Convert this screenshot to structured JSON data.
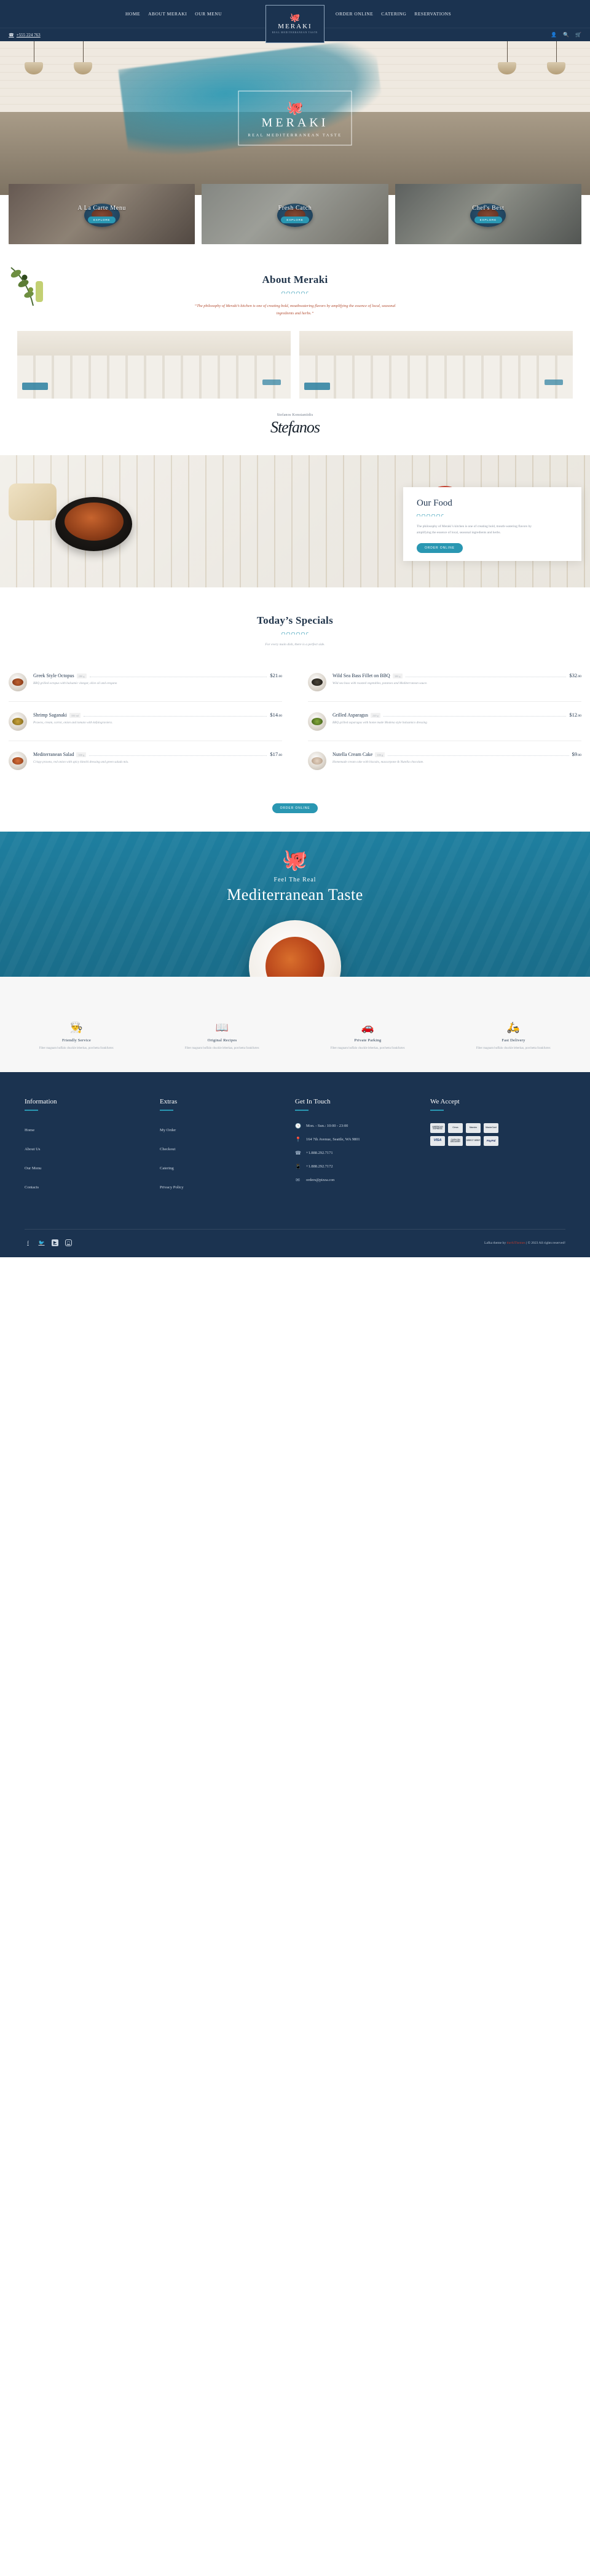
{
  "header": {
    "nav_left": [
      {
        "label": "HOME"
      },
      {
        "label": "ABOUT MERAKI"
      },
      {
        "label": "OUR MENU"
      }
    ],
    "nav_right": [
      {
        "label": "ORDER ONLINE"
      },
      {
        "label": "CATERING"
      },
      {
        "label": "RESERVATIONS"
      }
    ],
    "logo": {
      "mark": "🐙",
      "word": "MERAKI",
      "tagline": "REAL MEDITERRANEAN TASTE"
    },
    "phone": "+555 224 763",
    "phone_icon": "phone-icon",
    "util_icons": [
      "user-icon",
      "search-icon",
      "cart-icon"
    ],
    "colors": {
      "navy": "#1b3350",
      "teal": "#2a97b2"
    }
  },
  "hero": {
    "octopus_icon": "🐙",
    "title": "MERAKI",
    "subtitle": "REAL MEDITERRANEAN TASTE"
  },
  "cards": [
    {
      "title": "A La Carte Menu",
      "button": "Explore"
    },
    {
      "title": "Fresh Catch",
      "button": "Explore"
    },
    {
      "title": "Chef's Best",
      "button": "Explore"
    }
  ],
  "about": {
    "title": "About Meraki",
    "text": "“The philosophy of Meraki’s kitchen is one of creating bold, mouthwatering flavors by amplifying the essence of local, seasonal ingredients and herbs.”",
    "signer_name": "Stefanos Konstantidis",
    "signature": "Stefanos"
  },
  "our_food": {
    "title": "Our Food",
    "text": "The philosophy of Meraki’s kitchen is one of creating bold, mouth-watering flavors by amplifying the essence of local, seasonal ingredients and herbs.",
    "button": "Order Online"
  },
  "specials": {
    "title": "Today’s Specials",
    "note": "For every main dish, there is a perfect side.",
    "button": "Order Online",
    "items": [
      {
        "name": "Greek Style Octopus",
        "weight": "280 g",
        "price": "$21",
        "cents": ".00",
        "desc": "BBQ grilled octopus with balsamic vinegar, olive oil and oregano",
        "thumb": "octopus-thumb"
      },
      {
        "name": "Wild Sea Bass Fillet on BBQ",
        "weight": "380 g",
        "price": "$32",
        "cents": ".00",
        "desc": "Wild sea bass with roasted vegetables, potatoes and Mediterranean sauce.",
        "thumb": "seabass-thumb"
      },
      {
        "name": "Shrimp Saganaki",
        "weight": "350 ml",
        "price": "$14",
        "cents": ".00",
        "desc": "Prawns, cream, carrot, onion and tomato with kefalograviera.",
        "thumb": "saganaki-thumb"
      },
      {
        "name": "Grilled Asparagus",
        "weight": "220 g",
        "price": "$12",
        "cents": ".00",
        "desc": "BBQ grilled asparagus with home made Modena style balsamico dressing",
        "thumb": "asparagus-thumb"
      },
      {
        "name": "Mediterranean Salad",
        "weight": "300 g",
        "price": "$17",
        "cents": ".00",
        "desc": "Crispy prawns, red onion with spicy kimchi dressing and green salads mix.",
        "thumb": "salad-thumb"
      },
      {
        "name": "Nutella Cream Cake",
        "weight": "180 g",
        "price": "$9",
        "cents": ".00",
        "desc": "Homemade cream cake with biscuits, mascarpone & Nutella chocolate.",
        "thumb": "cake-thumb"
      }
    ]
  },
  "banner": {
    "octopus_icon": "🐙",
    "line1": "Feel The Real",
    "line2": "Mediterranean Taste"
  },
  "features": [
    {
      "icon": "👨‍🍳",
      "icon_name": "waiter-icon",
      "title": "Friendly Service",
      "desc": "Fiber magnam buffalo chuckle leberkas, porchetta frankfurter."
    },
    {
      "icon": "📖",
      "icon_name": "recipe-book-icon",
      "title": "Original Recipes",
      "desc": "Fiber magnam buffalo chuckle leberkas, porchetta frankfurter."
    },
    {
      "icon": "🚗",
      "icon_name": "car-icon",
      "title": "Private Parking",
      "desc": "Fiber magnam buffalo chuckle leberkas, porchetta frankfurter."
    },
    {
      "icon": "🛵",
      "icon_name": "scooter-icon",
      "title": "Fast Delivery",
      "desc": "Fiber magnam buffalo chuckle leberkas, porchetta frankfurter."
    }
  ],
  "footer": {
    "col1": {
      "title": "Information",
      "links": [
        {
          "label": "Home"
        },
        {
          "label": "About Us"
        },
        {
          "label": "Our Menu"
        },
        {
          "label": "Contacts"
        }
      ]
    },
    "col2": {
      "title": "Extras",
      "links": [
        {
          "label": "My Order"
        },
        {
          "label": "Checkout"
        },
        {
          "label": "Catering"
        },
        {
          "label": "Privacy Policy"
        }
      ]
    },
    "col3": {
      "title": "Get In Touch",
      "items": [
        {
          "icon": "🕓",
          "icon_name": "clock-icon",
          "text": "Mon. - Sun.: 10:00 - 23:00"
        },
        {
          "icon": "📍",
          "icon_name": "pin-icon",
          "text": "164 7th Avenue, Seattle, WA 9801"
        },
        {
          "icon": "☎",
          "icon_name": "phone-icon",
          "text": "+1.888.292.7171"
        },
        {
          "icon": "📱",
          "icon_name": "mobile-icon",
          "text": "+1.888.292.7172"
        },
        {
          "icon": "✉",
          "icon_name": "email-icon",
          "text": "orders@pizza.con"
        }
      ]
    },
    "col4": {
      "title": "We Accept",
      "cards": [
        {
          "label": "AMERICAN EXPRESS",
          "style": "amex"
        },
        {
          "label": "Cirrus",
          "style": "plain"
        },
        {
          "label": "Maestro",
          "style": "plain"
        },
        {
          "label": "MasterCard",
          "style": "plain"
        },
        {
          "label": "VISA",
          "style": "visa"
        },
        {
          "label": "CASH ON DELIVERY",
          "style": "plain"
        },
        {
          "label": "DIRECT DEBIT",
          "style": "plain"
        },
        {
          "label": "PayPal",
          "style": "pp"
        }
      ]
    },
    "socials": [
      {
        "glyph": "f",
        "name": "facebook-icon"
      },
      {
        "glyph": "🐦",
        "name": "twitter-icon"
      },
      {
        "glyph": "▶",
        "name": "youtube-icon"
      },
      {
        "glyph": "▢",
        "name": "instagram-icon"
      }
    ],
    "copyright_prefix": "Lafka theme by ",
    "copyright_link": "theAlThemes",
    "copyright_suffix": " | © 2023 All rights reserved!"
  }
}
